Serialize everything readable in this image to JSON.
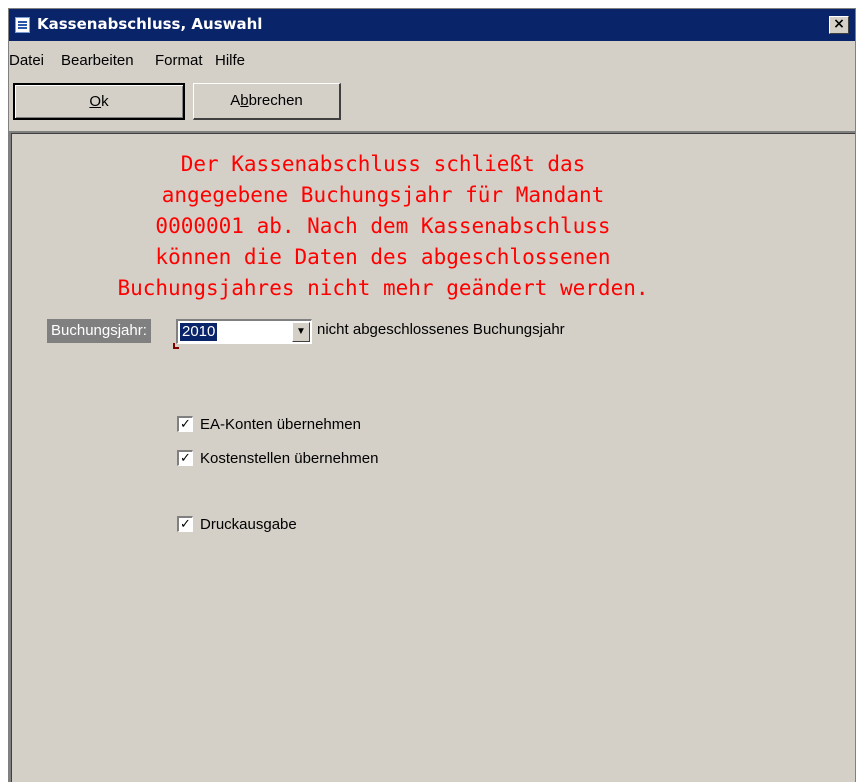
{
  "window": {
    "title": "Kassenabschluss, Auswahl",
    "close_label": "×"
  },
  "menu": {
    "items": [
      "Datei",
      "Bearbeiten",
      "Format",
      "Hilfe"
    ]
  },
  "toolbar": {
    "ok_label_mnemonic": "O",
    "ok_label_rest": "k",
    "cancel_label_pre": "A",
    "cancel_label_mnemonic": "b",
    "cancel_label_rest": "brechen"
  },
  "warning": {
    "text": "Der Kassenabschluss schließt das\nangegebene Buchungsjahr für Mandant\n0000001 ab. Nach dem Kassenabschluss\nkönnen die Daten des abgeschlossenen\nBuchungsjahres nicht mehr geändert werden.",
    "color": "#ff0000"
  },
  "year": {
    "label": "Buchungsjahr:",
    "selected": "2010",
    "note": "nicht abgeschlossenes Buchungsjahr"
  },
  "options": [
    {
      "label": "EA-Konten übernehmen",
      "checked": true
    },
    {
      "label": "Kostenstellen übernehmen",
      "checked": true
    },
    {
      "label": "Druckausgabe",
      "checked": true
    }
  ],
  "icons": {
    "window_icon": "document-icon",
    "combo_arrow": "chevron-down-icon",
    "check_mark": "checkmark-icon"
  }
}
